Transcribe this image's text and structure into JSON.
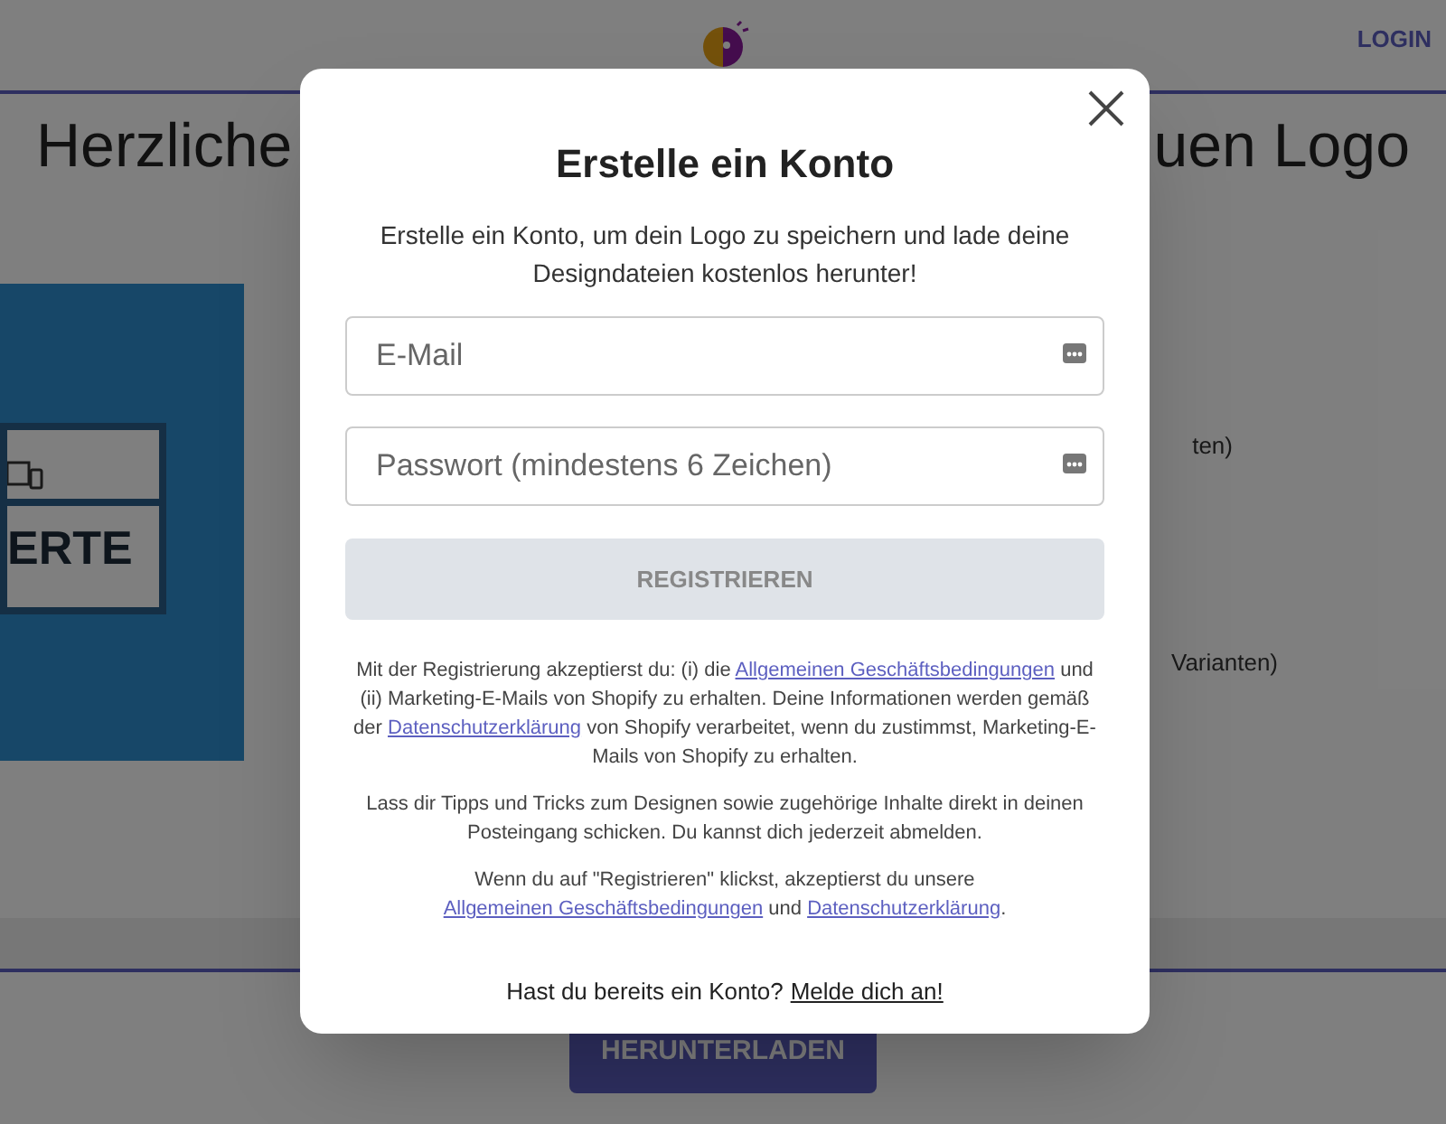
{
  "header": {
    "login": "LOGIN"
  },
  "page": {
    "heading_left": "Herzliche",
    "heading_right": "uen Logo",
    "logo_card_text": "ERTE",
    "option_1": "ten)",
    "option_2": "Varianten)",
    "download": "HERUNTERLADEN"
  },
  "modal": {
    "title": "Erstelle ein Konto",
    "subtitle": "Erstelle ein Konto, um dein Logo zu speichern und lade deine Designdateien kostenlos herunter!",
    "fields": [
      {
        "placeholder": "E-Mail"
      },
      {
        "placeholder": "Passwort (mindestens 6 Zeichen)"
      }
    ],
    "submit": {
      "label": "REGISTRIEREN",
      "disabled": true
    },
    "legal": [
      {
        "parts": [
          {
            "text": "Mit der Registrierung akzeptierst du: (i) die "
          },
          {
            "text": "Allgemeinen Geschäftsbedingungen",
            "link": true
          },
          {
            "text": " und (ii) Marketing-E-Mails von Shopify zu erhalten. Deine Informationen werden gemäß der "
          },
          {
            "text": "Datenschutzerklärung",
            "link": true
          },
          {
            "text": " von Shopify verarbeitet, wenn du zustimmst, Marketing-E-Mails von Shopify zu erhalten."
          }
        ]
      },
      {
        "parts": [
          {
            "text": "Lass dir Tipps und Tricks zum Designen sowie zugehörige Inhalte direkt in deinen Posteingang schicken. Du kannst dich jederzeit abmelden."
          }
        ]
      },
      {
        "parts": [
          {
            "text": "Wenn du auf \"Registrieren\" klickst, akzeptierst du unsere "
          },
          {
            "text": "Allgemeinen Geschäftsbedingungen",
            "link": true
          },
          {
            "text": " und "
          },
          {
            "text": "Datenschutzerklärung",
            "link": true
          },
          {
            "text": "."
          }
        ]
      }
    ],
    "login_prompt": "Hast du bereits ein Konto?",
    "login_link": "Melde dich an!"
  }
}
